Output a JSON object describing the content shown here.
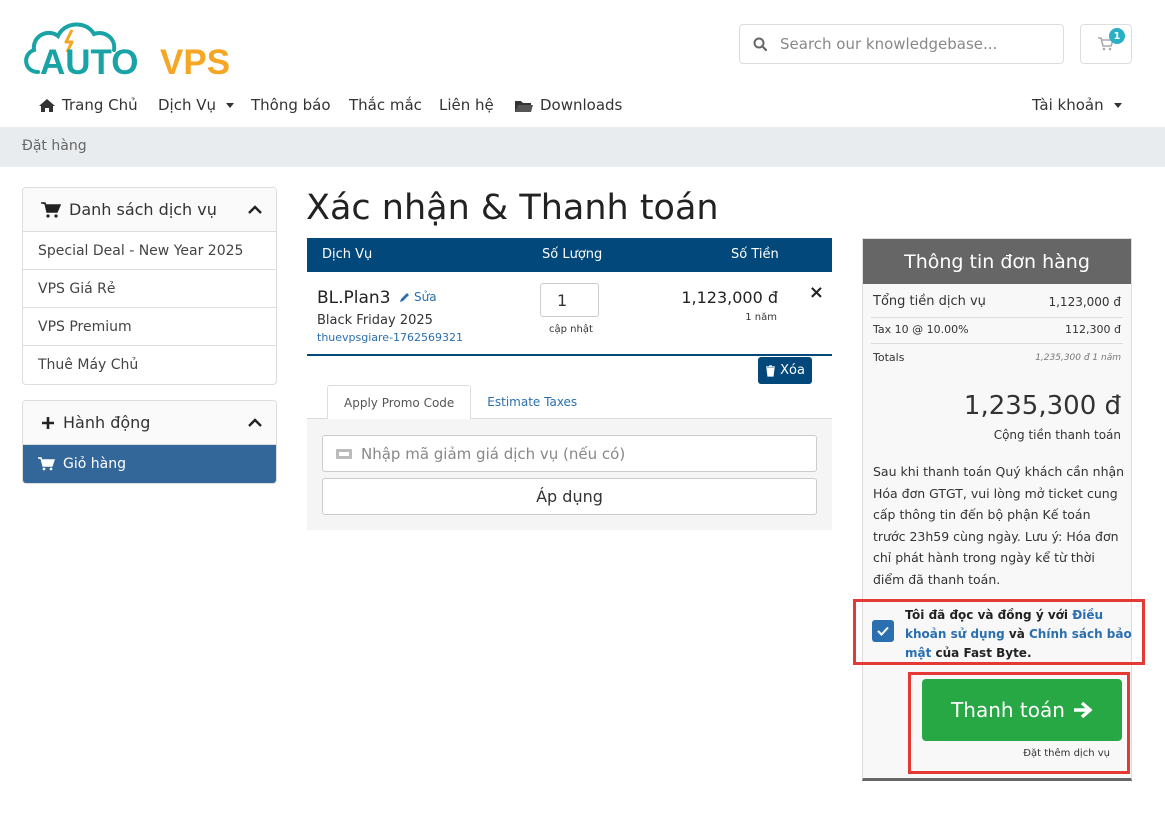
{
  "brand": {
    "auto": "AUTO",
    "vps": "VPS",
    "color_teal": "#1aa3a6",
    "color_orange": "#f5a623"
  },
  "search": {
    "placeholder": "Search our knowledgebase..."
  },
  "cart": {
    "badge": "1"
  },
  "nav": {
    "home": "Trang Chủ",
    "services": "Dịch Vụ",
    "announcements": "Thông báo",
    "faq": "Thắc mắc",
    "contact": "Liên hệ",
    "downloads": "Downloads",
    "account": "Tài khoản"
  },
  "breadcrumb": "Đặt hàng",
  "sidebar": {
    "categories_title": "Danh sách dịch vụ",
    "categories": [
      "Special Deal - New Year 2025",
      "VPS Giá Rẻ",
      "VPS Premium",
      "Thuê Máy Chủ"
    ],
    "actions_title": "Hành động",
    "actions": [
      "Giỏ hàng"
    ]
  },
  "page_title": "Xác nhận & Thanh toán",
  "cart_table": {
    "headers": {
      "service": "Dịch Vụ",
      "qty": "Số Lượng",
      "price": "Số Tiền"
    },
    "item": {
      "name": "BL.Plan3",
      "edit": "Sửa",
      "group": "Black Friday 2025",
      "hostname": "thuevpsgiare-1762569321",
      "qty": "1",
      "update": "cập nhật",
      "price": "1,123,000 đ",
      "cycle": "1 năm",
      "remove": "×"
    },
    "empty_button": "Xóa"
  },
  "promo": {
    "tab_promo": "Apply Promo Code",
    "tab_tax": "Estimate Taxes",
    "placeholder": "Nhập mã giảm giá dịch vụ (nếu có)",
    "apply": "Áp dụng"
  },
  "summary": {
    "title": "Thông tin đơn hàng",
    "subtotal_label": "Tổng tiền dịch vụ",
    "subtotal_value": "1,123,000 đ",
    "tax_label": "Tax 10 @ 10.00%",
    "tax_value": "112,300 đ",
    "totals_label": "Totals",
    "totals_value": "1,235,300 đ 1 năm",
    "grand_total": "1,235,300 đ",
    "grand_total_label": "Cộng tiền thanh toán",
    "note": "Sau khi thanh toán Quý khách cần nhận Hóa đơn GTGT, vui lòng mở ticket cung cấp thông tin đến bộ phận Kế toán trước 23h59 cùng ngày. Lưu ý: Hóa đơn chỉ phát hành trong ngày kể từ thời điểm đã thanh toán.",
    "agree_prefix": "Tôi đã đọc và đồng ý với ",
    "agree_terms": "Điều khoản sử dụng",
    "agree_and": " và ",
    "agree_privacy": "Chính sách bảo mật",
    "agree_suffix": " của Fast Byte.",
    "checkout": "Thanh toán",
    "continue": "Đặt thêm dịch vụ"
  }
}
